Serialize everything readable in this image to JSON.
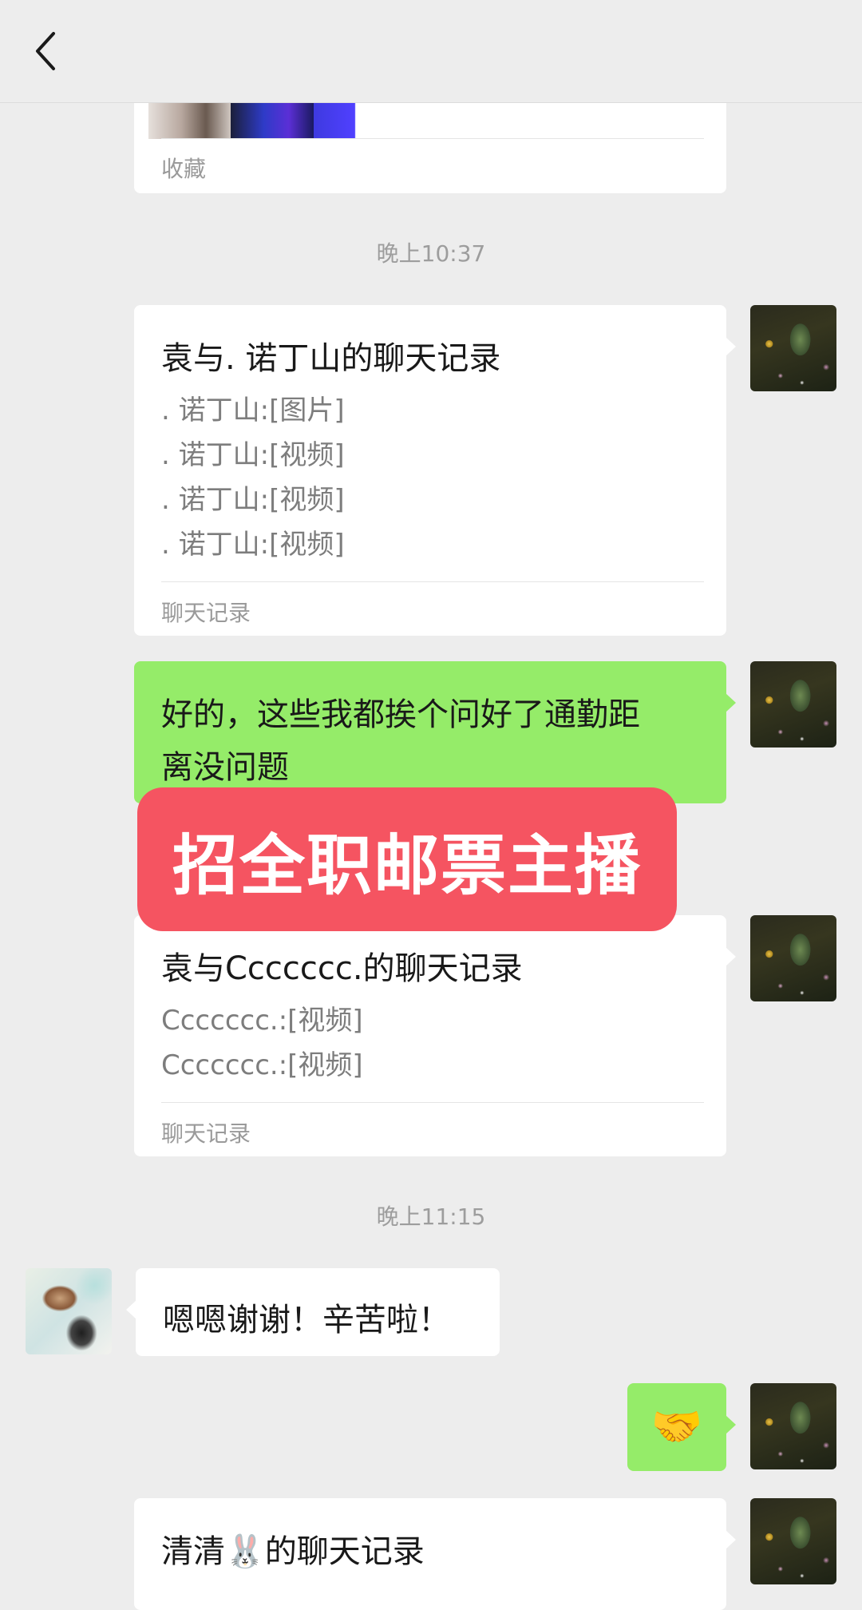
{
  "nav": {
    "back_icon": "chevron-left-icon"
  },
  "messages": [
    {
      "type": "favorite-card",
      "footer": "收藏"
    },
    {
      "type": "time",
      "text": "晚上10:37"
    },
    {
      "type": "chat-record",
      "sender": "self",
      "title": "袁与. 诺丁山的聊天记录",
      "lines": [
        ". 诺丁山:[图片]",
        ". 诺丁山:[视频]",
        ". 诺丁山:[视频]",
        ". 诺丁山:[视频]"
      ],
      "footer": "聊天记录"
    },
    {
      "type": "text",
      "sender": "self",
      "lines": [
        "好的，这些我都挨个问好了通勤距",
        "离没问题"
      ]
    },
    {
      "type": "chat-record",
      "sender": "self",
      "title": "袁与Ccccccc.的聊天记录",
      "lines": [
        "Ccccccc.:[视频]",
        "Ccccccc.:[视频]"
      ],
      "footer": "聊天记录"
    },
    {
      "type": "time",
      "text": "晚上11:15"
    },
    {
      "type": "text",
      "sender": "other",
      "text": "嗯嗯谢谢！辛苦啦！"
    },
    {
      "type": "emoji",
      "sender": "self",
      "emoji": "🤝"
    },
    {
      "type": "chat-record",
      "sender": "self",
      "title_prefix": "清清",
      "title_emoji": "🐰",
      "title_suffix": "的聊天记录"
    }
  ],
  "overlay_banner": {
    "text": "招全职邮票主播",
    "color": "#f55461"
  },
  "colors": {
    "background": "#ededed",
    "self_bubble": "#95ec69",
    "other_bubble": "#ffffff"
  }
}
